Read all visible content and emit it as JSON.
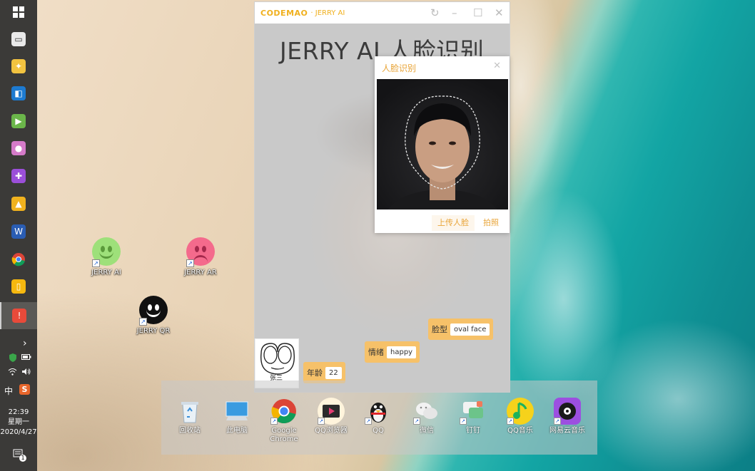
{
  "desktop": {
    "icons": [
      {
        "label": "JERRY AI",
        "color": "#9ee07a"
      },
      {
        "label": "JERRY AR",
        "color": "#f46a8c"
      },
      {
        "label": "JERRY QR",
        "color": "#111111"
      }
    ]
  },
  "taskbar": {
    "time": "22:39",
    "weekday": "星期一",
    "date": "2020/4/27",
    "ime": "中",
    "notification_count": "1",
    "expand_glyph": "›"
  },
  "app": {
    "logo": "CODEMAO",
    "subtitle": "· JERRY AI",
    "heading": "JERRY AI 人脸识别",
    "accent_color": "#f0b01e"
  },
  "tags": {
    "face_shape": {
      "label": "脸型",
      "value": "oval face"
    },
    "emotion": {
      "label": "情绪",
      "value": "happy"
    },
    "age": {
      "label": "年龄",
      "value": "22"
    }
  },
  "sketch": {
    "caption": "张三"
  },
  "dialog": {
    "title": "人脸识别",
    "close": "✕",
    "upload_button": "上传人脸",
    "capture_button": "拍照"
  },
  "dock": {
    "items": [
      {
        "label": "回收站",
        "icon": "recycle-bin-icon"
      },
      {
        "label": "此电脑",
        "icon": "computer-icon"
      },
      {
        "label": "Google Chrome",
        "icon": "chrome-icon"
      },
      {
        "label": "QQ浏览器",
        "icon": "qq-browser-icon"
      },
      {
        "label": "QQ",
        "icon": "qq-penguin-icon"
      },
      {
        "label": "微信",
        "icon": "wechat-icon"
      },
      {
        "label": "钉钉",
        "icon": "dingtalk-icon"
      },
      {
        "label": "QQ音乐",
        "icon": "qq-music-icon"
      },
      {
        "label": "网易云音乐",
        "icon": "netease-music-icon"
      }
    ]
  }
}
